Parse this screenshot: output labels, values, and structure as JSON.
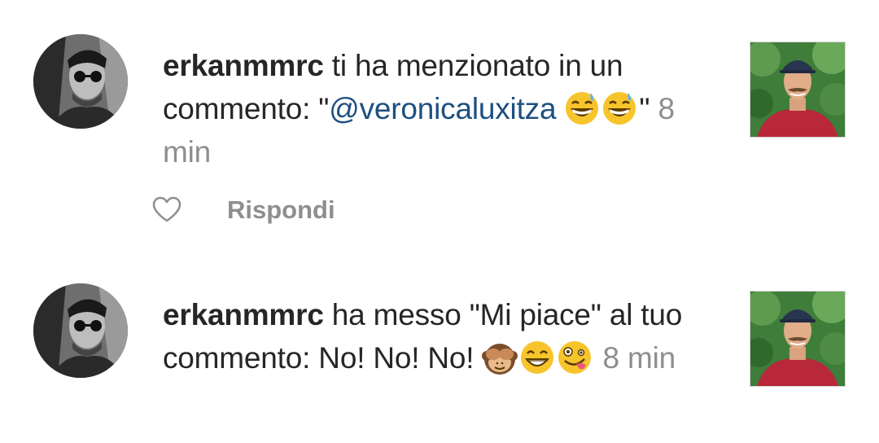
{
  "notifications": [
    {
      "username": "erkanmmrc",
      "message_before": " ti ha menzionato in un commento: \"",
      "mention": "@veronicaluxitza",
      "message_after": "\"",
      "time": " 8 min",
      "emojis": [
        "grinning-sweat-emoji",
        "grinning-sweat-emoji"
      ],
      "reply_label": "Rispondi"
    },
    {
      "username": "erkanmmrc",
      "message_before": " ha messo \"Mi piace\" al tuo commento: No! No! No! ",
      "time": " 8 min",
      "emojis": [
        "see-no-evil-monkey-emoji",
        "beaming-grin-emoji",
        "zany-face-emoji"
      ]
    }
  ],
  "colors": {
    "text": "#262626",
    "mention": "#1d4f80",
    "muted": "#8e8e8e"
  }
}
